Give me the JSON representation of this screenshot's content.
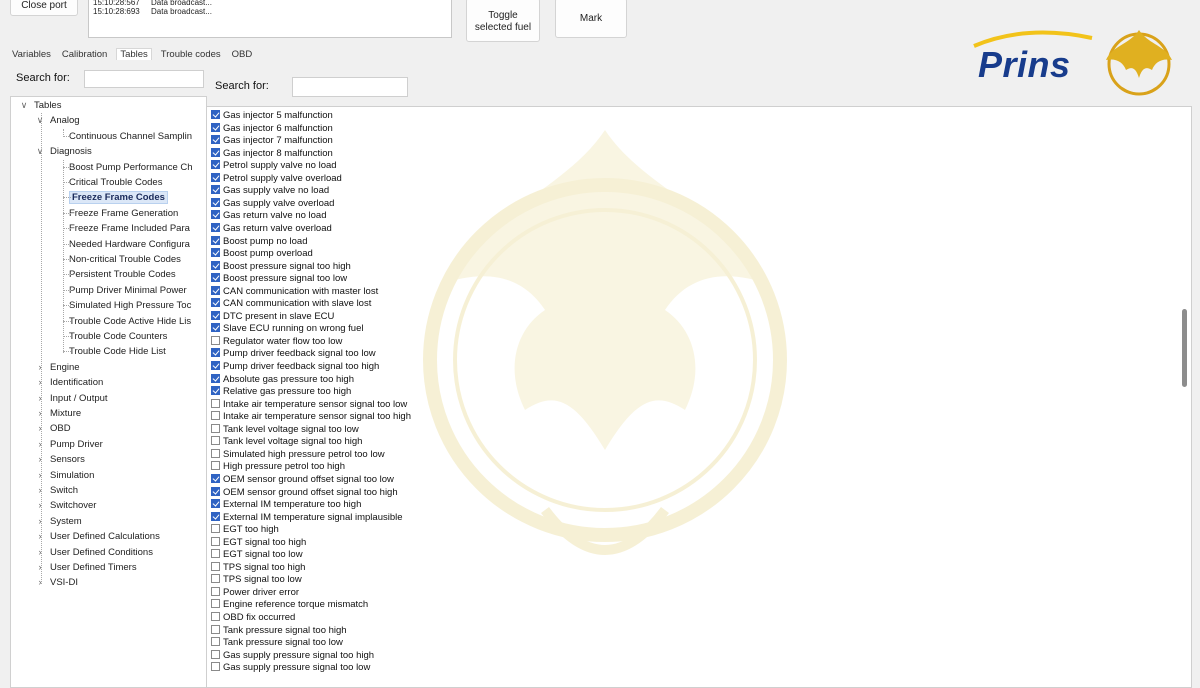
{
  "toolbar": {
    "close_port": "Close port",
    "toggle_selected_fuel": "Toggle\nselected fuel",
    "mark": "Mark"
  },
  "log": [
    {
      "time": "15:10:28:567",
      "msg": "Data broadcast..."
    },
    {
      "time": "15:10:28:693",
      "msg": "Data broadcast..."
    }
  ],
  "tabs": [
    "Variables",
    "Calibration",
    "Tables",
    "Trouble codes",
    "OBD"
  ],
  "active_tab": "Tables",
  "left_search": {
    "label": "Search for:",
    "value": ""
  },
  "right_search": {
    "label": "Search for:",
    "value": ""
  },
  "tree": [
    {
      "label": "Tables",
      "level": 0,
      "expand": "open"
    },
    {
      "label": "Analog",
      "level": 1,
      "expand": "open"
    },
    {
      "label": "Continuous Channel Samplin",
      "level": 2,
      "expand": "none"
    },
    {
      "label": "Diagnosis",
      "level": 1,
      "expand": "open"
    },
    {
      "label": "Boost Pump Performance Ch",
      "level": 2,
      "expand": "none"
    },
    {
      "label": "Critical Trouble Codes",
      "level": 2,
      "expand": "none"
    },
    {
      "label": "Freeze Frame Codes",
      "level": 2,
      "expand": "none",
      "selected": true
    },
    {
      "label": "Freeze Frame Generation",
      "level": 2,
      "expand": "none"
    },
    {
      "label": "Freeze Frame Included Para",
      "level": 2,
      "expand": "none"
    },
    {
      "label": "Needed Hardware Configura",
      "level": 2,
      "expand": "none"
    },
    {
      "label": "Non-critical Trouble Codes",
      "level": 2,
      "expand": "none"
    },
    {
      "label": "Persistent Trouble Codes",
      "level": 2,
      "expand": "none"
    },
    {
      "label": "Pump Driver Minimal Power",
      "level": 2,
      "expand": "none"
    },
    {
      "label": "Simulated High Pressure Toc",
      "level": 2,
      "expand": "none"
    },
    {
      "label": "Trouble Code Active Hide Lis",
      "level": 2,
      "expand": "none"
    },
    {
      "label": "Trouble Code Counters",
      "level": 2,
      "expand": "none"
    },
    {
      "label": "Trouble Code Hide List",
      "level": 2,
      "expand": "none"
    },
    {
      "label": "Engine",
      "level": 1,
      "expand": "closed"
    },
    {
      "label": "Identification",
      "level": 1,
      "expand": "closed"
    },
    {
      "label": "Input / Output",
      "level": 1,
      "expand": "closed"
    },
    {
      "label": "Mixture",
      "level": 1,
      "expand": "closed"
    },
    {
      "label": "OBD",
      "level": 1,
      "expand": "closed"
    },
    {
      "label": "Pump Driver",
      "level": 1,
      "expand": "closed"
    },
    {
      "label": "Sensors",
      "level": 1,
      "expand": "closed"
    },
    {
      "label": "Simulation",
      "level": 1,
      "expand": "closed"
    },
    {
      "label": "Switch",
      "level": 1,
      "expand": "closed"
    },
    {
      "label": "Switchover",
      "level": 1,
      "expand": "closed"
    },
    {
      "label": "System",
      "level": 1,
      "expand": "closed"
    },
    {
      "label": "User Defined Calculations",
      "level": 1,
      "expand": "closed"
    },
    {
      "label": "User Defined Conditions",
      "level": 1,
      "expand": "closed"
    },
    {
      "label": "User Defined Timers",
      "level": 1,
      "expand": "closed"
    },
    {
      "label": "VSI-DI",
      "level": 1,
      "expand": "closed"
    }
  ],
  "codes": [
    {
      "label": "Gas injector 5 malfunction",
      "checked": true
    },
    {
      "label": "Gas injector 6 malfunction",
      "checked": true
    },
    {
      "label": "Gas injector 7 malfunction",
      "checked": true
    },
    {
      "label": "Gas injector 8 malfunction",
      "checked": true
    },
    {
      "label": "Petrol supply valve no load",
      "checked": true
    },
    {
      "label": "Petrol supply valve overload",
      "checked": true
    },
    {
      "label": "Gas supply valve no load",
      "checked": true
    },
    {
      "label": "Gas supply valve overload",
      "checked": true
    },
    {
      "label": "Gas return valve no load",
      "checked": true
    },
    {
      "label": "Gas return valve overload",
      "checked": true
    },
    {
      "label": "Boost pump no load",
      "checked": true
    },
    {
      "label": "Boost pump overload",
      "checked": true
    },
    {
      "label": "Boost pressure signal too high",
      "checked": true
    },
    {
      "label": "Boost pressure signal too low",
      "checked": true
    },
    {
      "label": "CAN communication with master lost",
      "checked": true
    },
    {
      "label": "CAN communication with slave lost",
      "checked": true
    },
    {
      "label": "DTC present in slave ECU",
      "checked": true
    },
    {
      "label": "Slave ECU running on wrong fuel",
      "checked": true
    },
    {
      "label": "Regulator water flow too low",
      "checked": false
    },
    {
      "label": "Pump driver feedback signal too low",
      "checked": true
    },
    {
      "label": "Pump driver feedback signal too high",
      "checked": true
    },
    {
      "label": "Absolute gas pressure too high",
      "checked": true
    },
    {
      "label": "Relative gas pressure too high",
      "checked": true
    },
    {
      "label": "Intake air temperature sensor signal too low",
      "checked": false
    },
    {
      "label": "Intake air temperature sensor signal too high",
      "checked": false
    },
    {
      "label": "Tank level voltage signal too low",
      "checked": false
    },
    {
      "label": "Tank level voltage signal too high",
      "checked": false
    },
    {
      "label": "Simulated high pressure petrol too low",
      "checked": false
    },
    {
      "label": "High pressure petrol too high",
      "checked": false
    },
    {
      "label": "OEM sensor ground offset signal too low",
      "checked": true
    },
    {
      "label": "OEM sensor ground offset signal too high",
      "checked": true
    },
    {
      "label": "External IM temperature too high",
      "checked": true
    },
    {
      "label": "External IM temperature signal implausible",
      "checked": true
    },
    {
      "label": "EGT too high",
      "checked": false
    },
    {
      "label": "EGT signal too high",
      "checked": false
    },
    {
      "label": "EGT signal too low",
      "checked": false
    },
    {
      "label": "TPS signal too high",
      "checked": false
    },
    {
      "label": "TPS signal too low",
      "checked": false
    },
    {
      "label": "Power driver error",
      "checked": false
    },
    {
      "label": "Engine reference torque mismatch",
      "checked": false
    },
    {
      "label": "OBD fix occurred",
      "checked": false
    },
    {
      "label": "Tank pressure signal too high",
      "checked": false
    },
    {
      "label": "Tank pressure signal too low",
      "checked": false
    },
    {
      "label": "Gas supply pressure signal too high",
      "checked": false
    },
    {
      "label": "Gas supply pressure signal too low",
      "checked": false
    }
  ],
  "brand": {
    "name": "Prins",
    "color": "#183c8c",
    "accent": "#f2c31a"
  },
  "watermark_icon": "garuda-emblem-icon"
}
